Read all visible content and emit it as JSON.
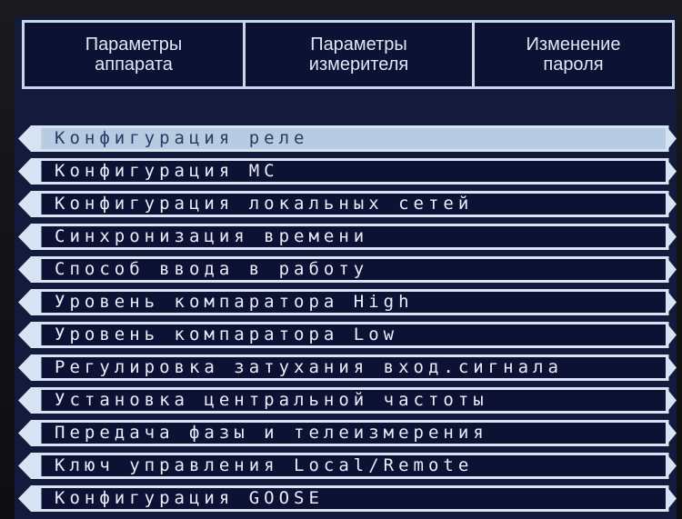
{
  "tabs": [
    {
      "label": "Параметры\nаппарата",
      "active": true
    },
    {
      "label": "Параметры\nизмерителя",
      "active": false
    },
    {
      "label": "Изменение\nпароля",
      "active": false
    }
  ],
  "menu": {
    "items": [
      {
        "label": "Конфигурация реле",
        "selected": true
      },
      {
        "label": "Конфигурация МС",
        "selected": false
      },
      {
        "label": "Конфигурация локальных сетей",
        "selected": false
      },
      {
        "label": "Синхронизация времени",
        "selected": false
      },
      {
        "label": "Способ ввода в работу",
        "selected": false
      },
      {
        "label": "Уровень компаратора High",
        "selected": false
      },
      {
        "label": "Уровень компаратора Low",
        "selected": false
      },
      {
        "label": "Регулировка затухания вход.сигнала",
        "selected": false
      },
      {
        "label": "Установка центральной частоты",
        "selected": false
      },
      {
        "label": "Передача фазы и телеизмерения",
        "selected": false
      },
      {
        "label": "Ключ управления Local/Remote",
        "selected": false
      },
      {
        "label": "Конфигурация GOOSE",
        "selected": false
      }
    ]
  },
  "colors": {
    "screen_bg": "#131a3b",
    "item_fill": "#0d1133",
    "item_border": "#d6e3f2",
    "selected_fill": "#b7cbe3",
    "arrow_fill": "#d6e3f2"
  },
  "icons": {
    "left_arrow": "left-arrow-icon",
    "right_arrow": "right-arrow-icon"
  }
}
